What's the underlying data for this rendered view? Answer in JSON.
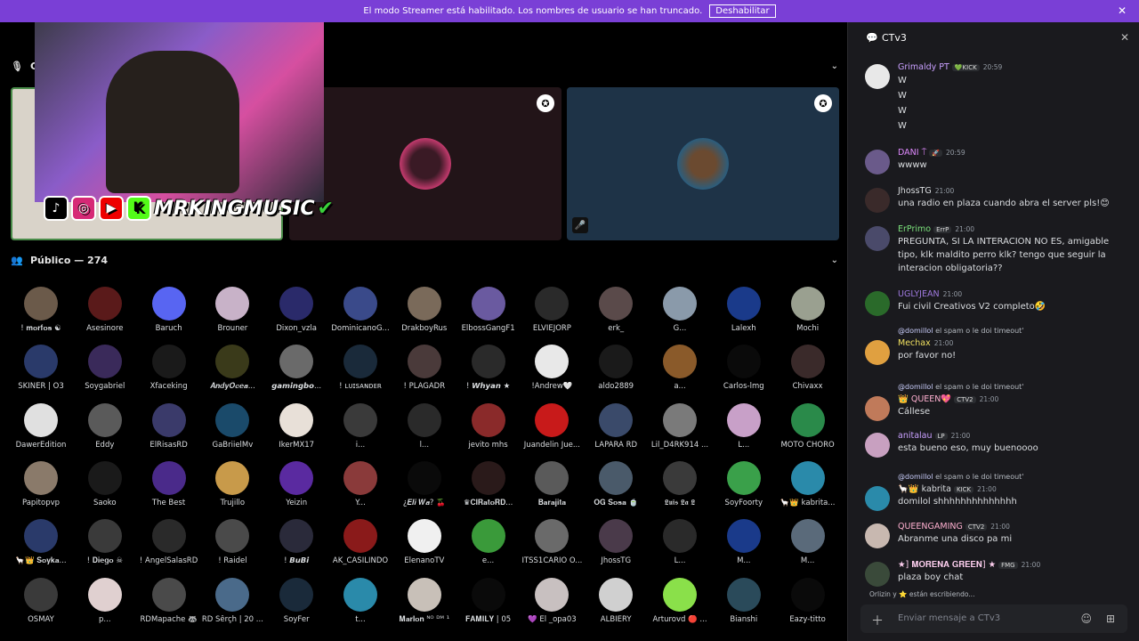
{
  "banner": {
    "text": "El modo Streamer está habilitado. Los nombres de usuario se han truncado.",
    "button": "Deshabilitar",
    "close": "✕"
  },
  "stage": {
    "section_initial": "C",
    "chevron": "⌄"
  },
  "overlay": {
    "brand": "MRKINGMUSIC",
    "check": "✔"
  },
  "public": {
    "title": "Público — 274",
    "chevron": "⌄"
  },
  "members": [
    {
      "name": "! 𝐦𝐨𝐫𝐟𝐨𝐬 ☯",
      "color": "#6b5a4a"
    },
    {
      "name": "Asesinore",
      "color": "#5a1a1a"
    },
    {
      "name": "Baruch",
      "color": "#5865f2"
    },
    {
      "name": "Brouner",
      "color": "#c8b2c8"
    },
    {
      "name": "Dixon_vzla",
      "color": "#2a2a6a"
    },
    {
      "name": "DominicanoG...",
      "color": "#3a4a8a"
    },
    {
      "name": "DrakboyRus",
      "color": "#7a6a5a"
    },
    {
      "name": "ElbossGangF1",
      "color": "#6a5aa0"
    },
    {
      "name": "ELVIEJORP",
      "color": "#2a2a2a"
    },
    {
      "name": "erk_",
      "color": "#5a4a4a"
    },
    {
      "name": "G...",
      "color": "#8a9aaa"
    },
    {
      "name": "Lalexh",
      "color": "#1a3a8a"
    },
    {
      "name": "Mochi",
      "color": "#9aa090"
    },
    {
      "name": "SKINER | O3",
      "color": "#2a3a6a"
    },
    {
      "name": "Soygabriel",
      "color": "#3a2a5a"
    },
    {
      "name": "Xfaceking",
      "color": "#1a1a1a"
    },
    {
      "name": "𝑨𝒏𝒅𝒚𝑶𝒄𝒆𝒂...",
      "color": "#3a3a1a"
    },
    {
      "name": "𝙜𝙖𝙢𝙞𝙣𝙜𝙗𝙤...",
      "color": "#6a6a6a"
    },
    {
      "name": "! ʟᴜɪsᴀɴᴅᴇʀ",
      "color": "#1a2a3a"
    },
    {
      "name": "! PLAGADR",
      "color": "#4a3a3a"
    },
    {
      "name": "! 𝙒𝙝𝙮𝙖𝙣 ★",
      "color": "#2a2a2a"
    },
    {
      "name": "!Andrew🤍",
      "color": "#e8e8e8"
    },
    {
      "name": "aldo2889",
      "color": "#1a1a1a"
    },
    {
      "name": "a...",
      "color": "#8a5a2a"
    },
    {
      "name": "Carlos-lmg",
      "color": "#0a0a0a"
    },
    {
      "name": "Chivaxx",
      "color": "#3a2a2a"
    },
    {
      "name": "DawerEdition",
      "color": "#e0e0e0"
    },
    {
      "name": "Eddy",
      "color": "#5a5a5a"
    },
    {
      "name": "ElRisasRD",
      "color": "#3a3a6a"
    },
    {
      "name": "GaBriielMv",
      "color": "#1a4a6a"
    },
    {
      "name": "IkerMX17",
      "color": "#e8e0d8"
    },
    {
      "name": "i...",
      "color": "#3a3a3a"
    },
    {
      "name": "l...",
      "color": "#2a2a2a"
    },
    {
      "name": "jevito mhs",
      "color": "#8a2a2a"
    },
    {
      "name": "Juandelin Jue...",
      "color": "#c81a1a"
    },
    {
      "name": "LAPARA RD",
      "color": "#3a4a6a"
    },
    {
      "name": "Lil_D4RK914 ...",
      "color": "#7a7a7a"
    },
    {
      "name": "L...",
      "color": "#c8a0c8"
    },
    {
      "name": "MOTO CHORO",
      "color": "#2a8a4a"
    },
    {
      "name": "Papitopvp",
      "color": "#8a7a6a"
    },
    {
      "name": "Saoko",
      "color": "#1a1a1a"
    },
    {
      "name": "The Best",
      "color": "#4a2a8a"
    },
    {
      "name": "Trujillo",
      "color": "#c89a4a"
    },
    {
      "name": "Yeizin",
      "color": "#5a2aa0"
    },
    {
      "name": "Y...",
      "color": "#8a3a3a"
    },
    {
      "name": "¿𝑬𝒍𝒊 𝑾𝒂? 🍒",
      "color": "#0a0a0a"
    },
    {
      "name": "♛𝐂𝐥𝐑𝐚𝐭𝐨𝐑𝐃...",
      "color": "#2a1a1a"
    },
    {
      "name": "𝐁𝐚𝐫𝐚𝐣𝐢𝐭𝐚",
      "color": "#5a5a5a"
    },
    {
      "name": "𝐎𝐆 𝐒𝐨𝐬𝐚 🍵",
      "color": "#4a5a6a"
    },
    {
      "name": "𝕷𝖚𝖎𝖘 𝕷𝖆 𝕷",
      "color": "#3a3a3a"
    },
    {
      "name": "SoyFoorty",
      "color": "#3aa04a"
    },
    {
      "name": "🦙👑 kabrita...",
      "color": "#2a8aaa"
    },
    {
      "name": "🦙👑 𝐒𝐨𝐲𝐤𝐚...",
      "color": "#2a3a6a"
    },
    {
      "name": "! 𝐃𝐢𝐞𝐠𝐨 ☠",
      "color": "#3a3a3a"
    },
    {
      "name": "! AngelSalasRD",
      "color": "#2a2a2a"
    },
    {
      "name": "! Raidel",
      "color": "#4a4a4a"
    },
    {
      "name": "! 𝘽𝙪𝘽𝙞",
      "color": "#2a2a3a"
    },
    {
      "name": "AK_CASILINDO",
      "color": "#8a1a1a"
    },
    {
      "name": "ElenanoTV",
      "color": "#f0f0f0"
    },
    {
      "name": "e...",
      "color": "#3a9a3a"
    },
    {
      "name": "ITSS1CARIO O...",
      "color": "#6a6a6a"
    },
    {
      "name": "JhossTG",
      "color": "#4a3a4a"
    },
    {
      "name": "L...",
      "color": "#2a2a2a"
    },
    {
      "name": "M...",
      "color": "#1a3a8a"
    },
    {
      "name": "M...",
      "color": "#5a6a7a"
    },
    {
      "name": "OSMAY",
      "color": "#3a3a3a"
    },
    {
      "name": "p...",
      "color": "#e0d0d0"
    },
    {
      "name": "RDMapache 🦝",
      "color": "#4a4a4a"
    },
    {
      "name": "RD Šêrçh | 20 ...",
      "color": "#4a6a8a"
    },
    {
      "name": "SoyFer",
      "color": "#1a2a3a"
    },
    {
      "name": "t...",
      "color": "#2a8aaa"
    },
    {
      "name": "𝐌𝐚𝐫𝐥𝐨𝐧 ᴺᴼ ᴰᴹ ¹",
      "color": "#c8c0b8"
    },
    {
      "name": "𝐅𝐀𝐌𝐈𝐋𝐘 | 05",
      "color": "#0a0a0a"
    },
    {
      "name": "💜 El _opa03",
      "color": "#c8c0c0"
    },
    {
      "name": "ALBIERY",
      "color": "#d0d0d0"
    },
    {
      "name": "Arturovd 🔴 ...",
      "color": "#8ae04a"
    },
    {
      "name": "Bianshi",
      "color": "#2a4a5a"
    },
    {
      "name": "Eazy-titto",
      "color": "#0a0a0a"
    }
  ],
  "chat": {
    "title": "CTv3",
    "close": "✕",
    "messages": [
      {
        "name": "Grimaldy PT",
        "name_color": "#c9a0ff",
        "tag": "💚KICK",
        "time": "20:59",
        "body": "W\nW\nW\nW",
        "avatar": "#e8e8e8"
      },
      {
        "name": "DANI ⍑",
        "name_color": "#e08aff",
        "tag": "🚀",
        "time": "20:59",
        "body": "wwww",
        "avatar": "#6a5a8a"
      },
      {
        "name": "JhossTG",
        "name_color": "#dbdee1",
        "tag": "",
        "time": "21:00",
        "body": "una radio en plaza cuando abra el server pls!😊",
        "avatar": "#3a2a2a"
      },
      {
        "name": "ErPrimo",
        "name_color": "#7be07b",
        "tag": "ErrP",
        "time": "21:00",
        "body": "PREGUNTA, SI LA INTERACION NO ES, amigable tipo, klk  maldito perro klk? tengo que seguir la interacion obligatoria??",
        "avatar": "#4a4a6a"
      },
      {
        "name": "UGLYJEAN",
        "name_color": "#a07ae0",
        "tag": "",
        "time": "21:00",
        "body": "Fui civil Creativos V2 completo🤣",
        "avatar": "#2a6a2a"
      },
      {
        "reply_user": "@domillol",
        "reply_text": "el spam  o  le  doi  timeout'",
        "name": "Mechax",
        "name_color": "#f0e060",
        "tag": "",
        "time": "21:00",
        "body": "por favor no!",
        "avatar": "#e0a040"
      },
      {
        "reply_user": "@domillol",
        "reply_text": "el spam  o  le  doi  timeout'",
        "name": "👑 QUEEN💖",
        "name_color": "#ffb0d0",
        "tag": "CTV2",
        "time": "21:00",
        "body": "Cállese",
        "avatar": "#c07a5a"
      },
      {
        "name": "anitalau",
        "name_color": "#c9a0ff",
        "tag": "LP",
        "time": "21:00",
        "body": "esta bueno eso, muy buenoooo",
        "avatar": "#c8a0c0"
      },
      {
        "reply_user": "@domillol",
        "reply_text": "el spam  o  le  doi  timeout'",
        "name": "🦙👑 kabrita",
        "name_color": "#dbdee1",
        "tag": "KICK",
        "time": "21:00",
        "body": "domilol shhhhhhhhhhhhhh",
        "avatar": "#2a8aaa"
      },
      {
        "name": "QUEENGAMING",
        "name_color": "#ffb0d0",
        "tag": "CTV2",
        "time": "21:00",
        "body": "Abranme una disco pa mi",
        "avatar": "#c8b8b0"
      },
      {
        "name": "★] 𝐌𝐎𝐑𝐄𝐍𝐀 𝐆𝐑𝐄𝐄𝐍] ★",
        "name_color": "#ffd0f0",
        "tag": "FMG",
        "time": "21:00",
        "body": "plaza boy chat",
        "avatar": "#3a4a3a"
      }
    ],
    "typing": "Orlizin y ⭐ están escribiendo...",
    "input_placeholder": "Enviar mensaje a CTv3"
  }
}
